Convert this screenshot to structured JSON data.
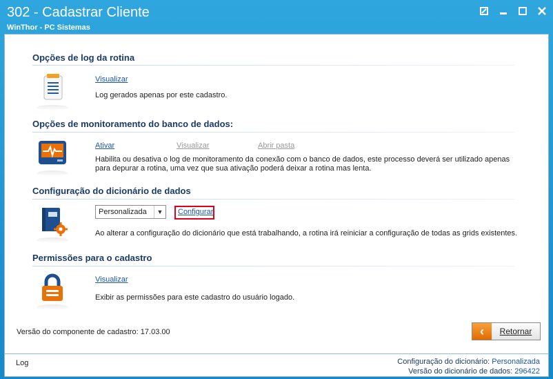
{
  "window": {
    "title": "302 - Cadastrar Cliente",
    "subtitle": "WinThor - PC Sistemas",
    "buttons": [
      "restore",
      "minimize",
      "maximize",
      "close"
    ]
  },
  "sections": {
    "log": {
      "title": "Opções de log da rotina",
      "link": "Visualizar",
      "description": "Log gerados apenas por este cadastro."
    },
    "monitor": {
      "title": "Opções de monitoramento do banco de dados:",
      "link_ativar": "Ativar",
      "link_visualizar": "Visualizar",
      "link_abrir": "Abrir pasta",
      "description_line1": "Habilita ou desativa o log de monitoramento da conexão com o banco de dados, este processo deverá ser utilizado apenas",
      "description_line2": "para depurar a rotina, uma vez que sua ativação poderá deixar a rotina mas lenta."
    },
    "dictionary": {
      "title": "Configuração do dicionário de dados",
      "select_value": "Personalizada",
      "link_configurar": "Configurar",
      "description": "Ao alterar a configuração do dicionário que está trabalhando, a rotina irá reiniciar a configuração de todas as grids existentes."
    },
    "permissions": {
      "title": "Permissões para o cadastro",
      "link": "Visualizar",
      "description": "Exibir as permissões para este cadastro do usuário logado."
    }
  },
  "version_text": "Versão do componente de cadastro: 17.03.00",
  "return_button": "Retornar",
  "footer": {
    "log_label": "Log",
    "config_label": "Configuração do dicionário:",
    "config_value": "Personalizada",
    "version_label": "Versão do dicionário de dados:",
    "version_value": "296422"
  },
  "colors": {
    "titlebar": "#1f99d6",
    "accent_orange": "#e8710a",
    "highlight_red": "#e0001b",
    "link_blue": "#1a55a8"
  },
  "icons": [
    "document-list-icon",
    "monitor-pulse-icon",
    "book-gear-icon",
    "padlock-icon",
    "arrow-left-icon"
  ]
}
